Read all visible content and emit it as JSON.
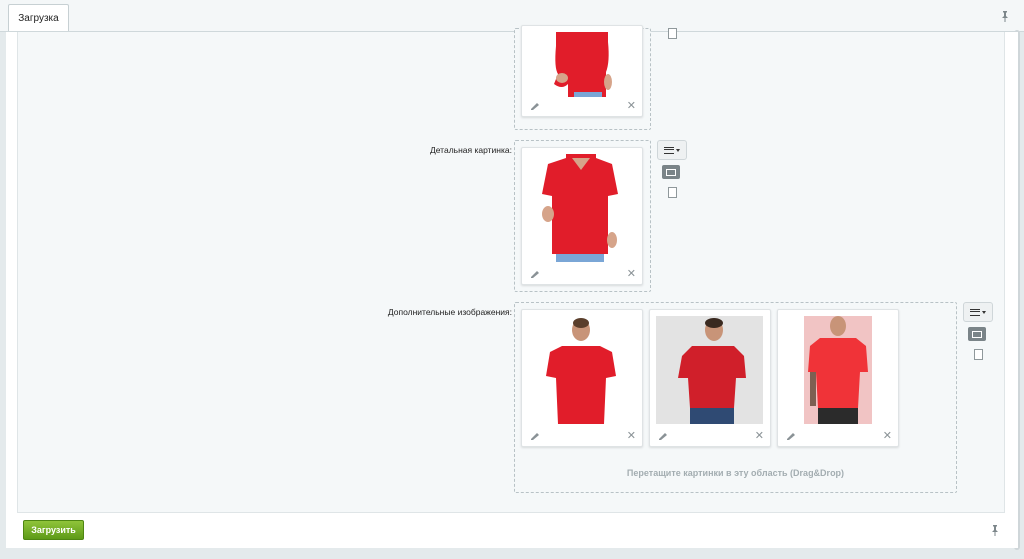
{
  "tabs": [
    {
      "label": "Загрузка"
    }
  ],
  "fields": {
    "detail_picture_label": "Детальная картинка:",
    "more_images_label": "Дополнительные изображения:"
  },
  "dropzone": {
    "hint": "Перетащите картинки в эту область (Drag&Drop)"
  },
  "footer": {
    "upload_label": "Загрузить"
  },
  "colors": {
    "accent_green": "#6aa51f",
    "tshirt_red": "#e11d2a",
    "panel_bg": "#f5f8f9"
  },
  "icons": {
    "pin": "pin-icon",
    "edit": "pencil-icon",
    "delete": "close-icon",
    "menu": "hamburger-menu-icon",
    "image": "image-icon",
    "file": "file-icon"
  }
}
